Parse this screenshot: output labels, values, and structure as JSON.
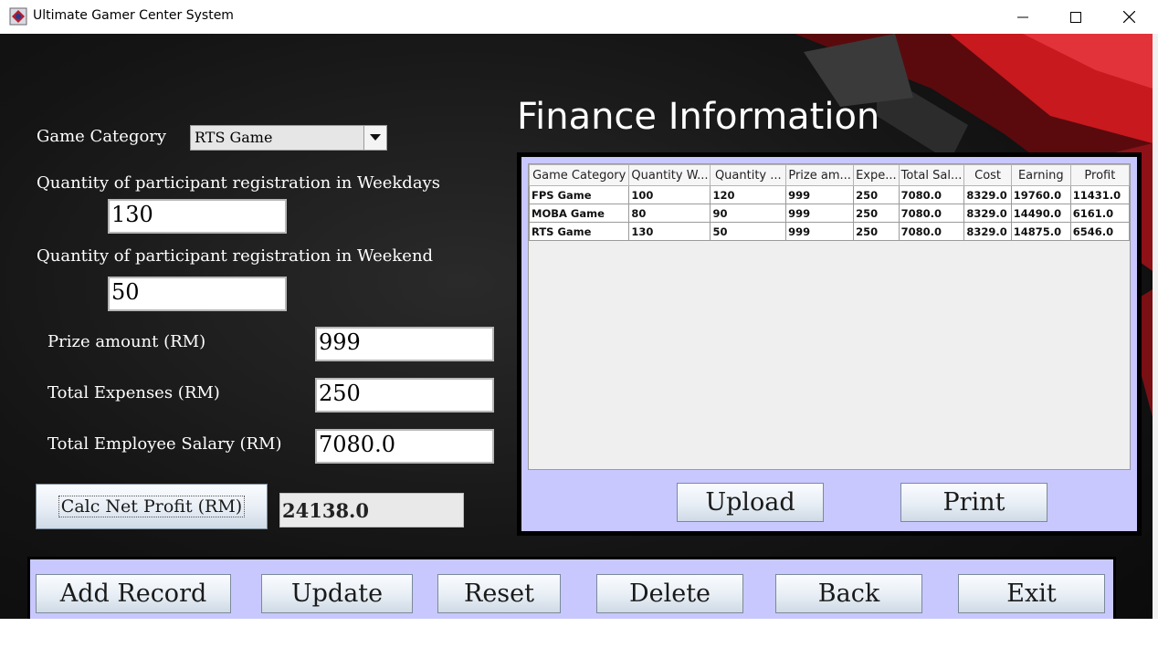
{
  "window": {
    "title": "Ultimate Gamer Center System",
    "minimize_icon": "minimize-icon",
    "maximize_icon": "maximize-icon",
    "close_icon": "close-icon"
  },
  "form": {
    "game_category_label": "Game Category",
    "game_category_value": "RTS Game",
    "weekdays_label": "Quantity of participant registration in Weekdays",
    "weekdays_value": "130",
    "weekend_label": "Quantity of participant registration in Weekend",
    "weekend_value": "50",
    "prize_label": "Prize amount (RM)",
    "prize_value": "999",
    "expenses_label": "Total Expenses (RM)",
    "expenses_value": "250",
    "salary_label": "Total Employee Salary (RM)",
    "salary_value": "7080.0",
    "calc_button": "Calc Net Profit (RM)",
    "net_profit_value": "24138.0"
  },
  "finance": {
    "title": "Finance Information",
    "columns": [
      "Game Category",
      "Quantity W...",
      "Quantity ...",
      "Prize am...",
      "Expe...",
      "Total Sal...",
      "Cost",
      "Earning",
      "Profit"
    ],
    "rows": [
      [
        "FPS Game",
        "100",
        "120",
        "999",
        "250",
        "7080.0",
        "8329.0",
        "19760.0",
        "11431.0"
      ],
      [
        "MOBA Game",
        "80",
        "90",
        "999",
        "250",
        "7080.0",
        "8329.0",
        "14490.0",
        "6161.0"
      ],
      [
        "RTS Game",
        "130",
        "50",
        "999",
        "250",
        "7080.0",
        "8329.0",
        "14875.0",
        "6546.0"
      ]
    ],
    "upload_button": "Upload",
    "print_button": "Print"
  },
  "actions": {
    "add": "Add Record",
    "update": "Update",
    "reset": "Reset",
    "delete": "Delete",
    "back": "Back",
    "exit": "Exit"
  },
  "colors": {
    "panel": "#c8c8ff",
    "background": "#141414",
    "accent_red": "#c8191e"
  }
}
